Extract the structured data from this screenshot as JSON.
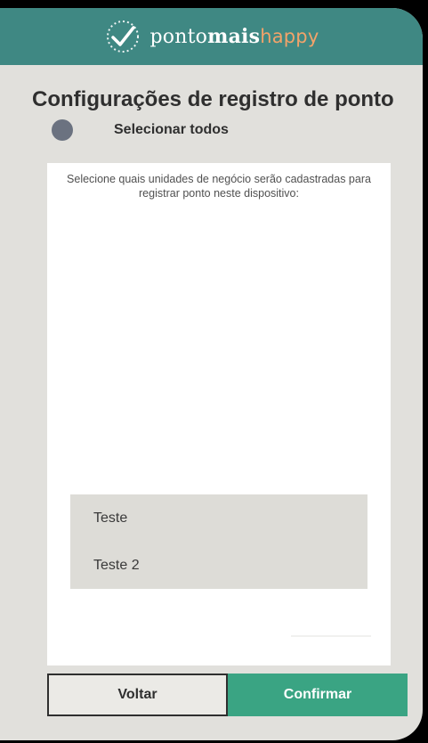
{
  "header": {
    "brand_part1": "ponto",
    "brand_part2": "mais",
    "brand_part3": "happy",
    "logo_icon": "checkmark-circle-icon",
    "background_color": "#3f8883"
  },
  "page": {
    "title": "Configurações de registro de ponto",
    "select_all_label": "Selecionar todos",
    "instructions": "Selecione quais unidades de negócio serão cadastradas para registrar ponto neste dispositivo:"
  },
  "units": [
    {
      "label": "Teste"
    },
    {
      "label": "Teste 2"
    }
  ],
  "actions": {
    "back_label": "Voltar",
    "confirm_label": "Confirmar",
    "confirm_color": "#3aa483"
  }
}
